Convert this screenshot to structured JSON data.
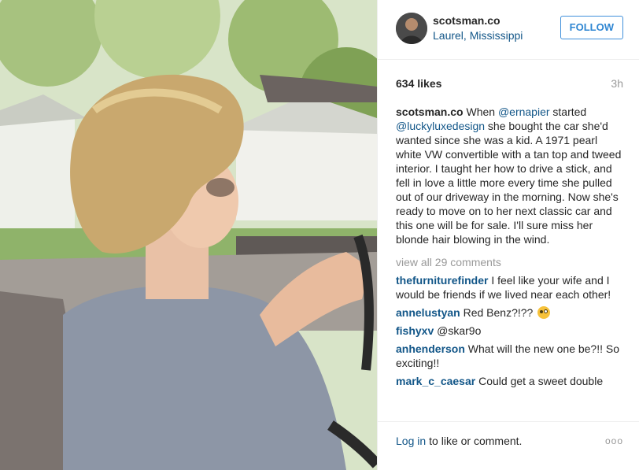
{
  "post": {
    "username": "scotsman.co",
    "location": "Laurel, Mississippi",
    "follow_label": "FOLLOW",
    "likes": "634 likes",
    "time": "3h",
    "caption": {
      "user": "scotsman.co",
      "t1": " When ",
      "m1": "@ernapier",
      "t2": " started ",
      "m2": "@luckyluxedesign",
      "t3": " she bought the car she'd wanted since she was a kid. A 1971 pearl white VW convertible with a tan top and tweed interior. I taught her how to drive a stick, and fell in love a little more every time she pulled out of our driveway in the morning. Now she's ready to move on to her next classic car and this one will be for sale. I'll sure miss her blonde hair blowing in the wind."
    },
    "view_all": "view all 29 comments",
    "comments": [
      {
        "user": "thefurniturefinder",
        "text": " I feel like your wife and I would be friends if we lived near each other!"
      },
      {
        "user": "annelustyan",
        "text": " Red Benz?!?? "
      },
      {
        "user": "fishyxv",
        "text": " @skar9o"
      },
      {
        "user": "anhenderson",
        "text": " What will the new one be?!! So exciting!!"
      },
      {
        "user": "mark_c_caesar",
        "text": " Could get a sweet double"
      }
    ],
    "footer": {
      "login": "Log in",
      "rest": "to like or comment.",
      "more": "ooo"
    }
  },
  "icons": {
    "emoji": "winking-face-icon",
    "more": "more-options-icon"
  }
}
